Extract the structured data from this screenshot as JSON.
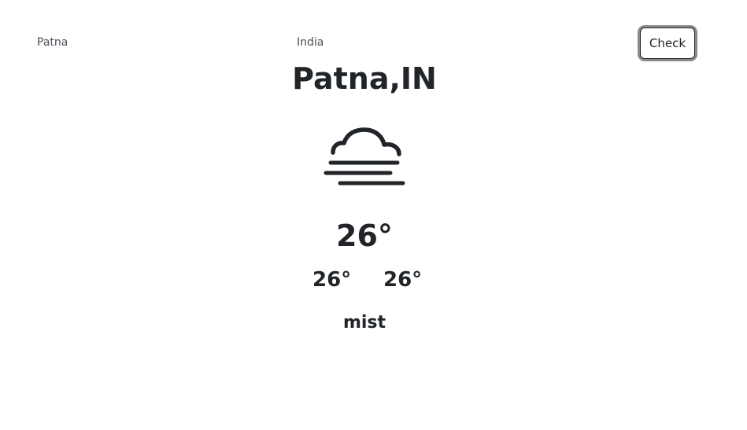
{
  "form": {
    "city_value": "Patna",
    "country_value": "India",
    "check_label": "Check"
  },
  "weather": {
    "location": "Patna,IN",
    "icon": "fog-cloud-icon",
    "temperature": "26°",
    "temp_min": "26°",
    "temp_max": "26°",
    "description": "mist"
  }
}
